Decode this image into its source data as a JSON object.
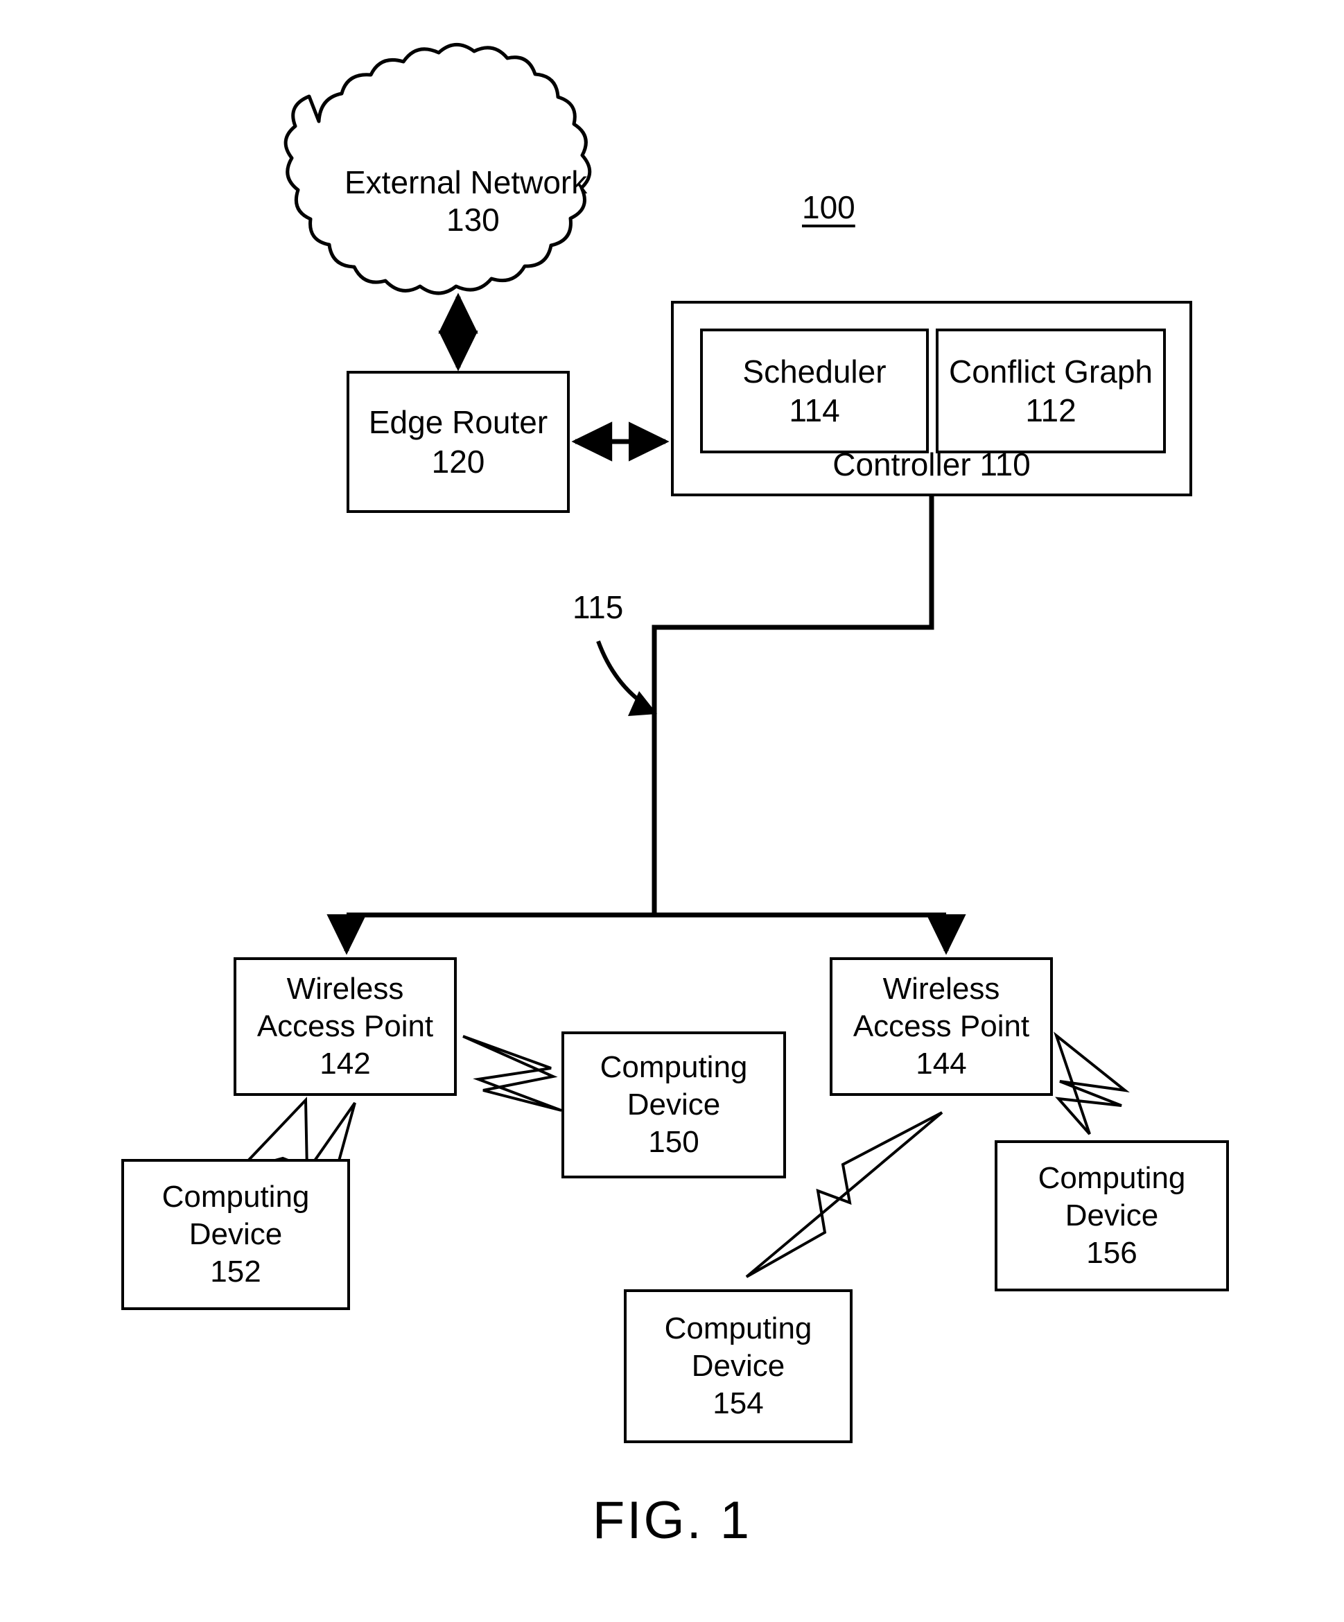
{
  "figure": {
    "caption": "FIG. 1",
    "system_reference": "100"
  },
  "cloud": {
    "name": "cloud-shape",
    "title": "External Network",
    "ref": "130"
  },
  "nodes": {
    "edge_router": {
      "title": "Edge Router",
      "ref": "120"
    },
    "controller": {
      "title": "Controller 110",
      "ref": "110"
    },
    "scheduler": {
      "title": "Scheduler",
      "ref": "114"
    },
    "conflict_graph": {
      "title": "Conflict Graph",
      "ref": "112"
    },
    "wap_142": {
      "line1": "Wireless",
      "line2": "Access Point",
      "ref": "142"
    },
    "wap_144": {
      "line1": "Wireless",
      "line2": "Access Point",
      "ref": "144"
    },
    "cd_150": {
      "line1": "Computing",
      "line2": "Device",
      "ref": "150"
    },
    "cd_152": {
      "line1": "Computing",
      "line2": "Device",
      "ref": "152"
    },
    "cd_154": {
      "line1": "Computing",
      "line2": "Device",
      "ref": "154"
    },
    "cd_156": {
      "line1": "Computing",
      "line2": "Device",
      "ref": "156"
    }
  },
  "connections": {
    "bus_label": "115",
    "cloud_to_router": "bidirectional-arrow",
    "router_to_controller": "bidirectional-arrow",
    "controller_to_bus": "line",
    "bus_to_wap142": "down-arrow",
    "bus_to_wap144": "down-arrow",
    "wireless_links": [
      "wap142-cd150",
      "wap142-cd152",
      "wap144-cd154",
      "wap144-cd156"
    ]
  },
  "style": {
    "stroke": "#000000",
    "background": "#ffffff"
  }
}
